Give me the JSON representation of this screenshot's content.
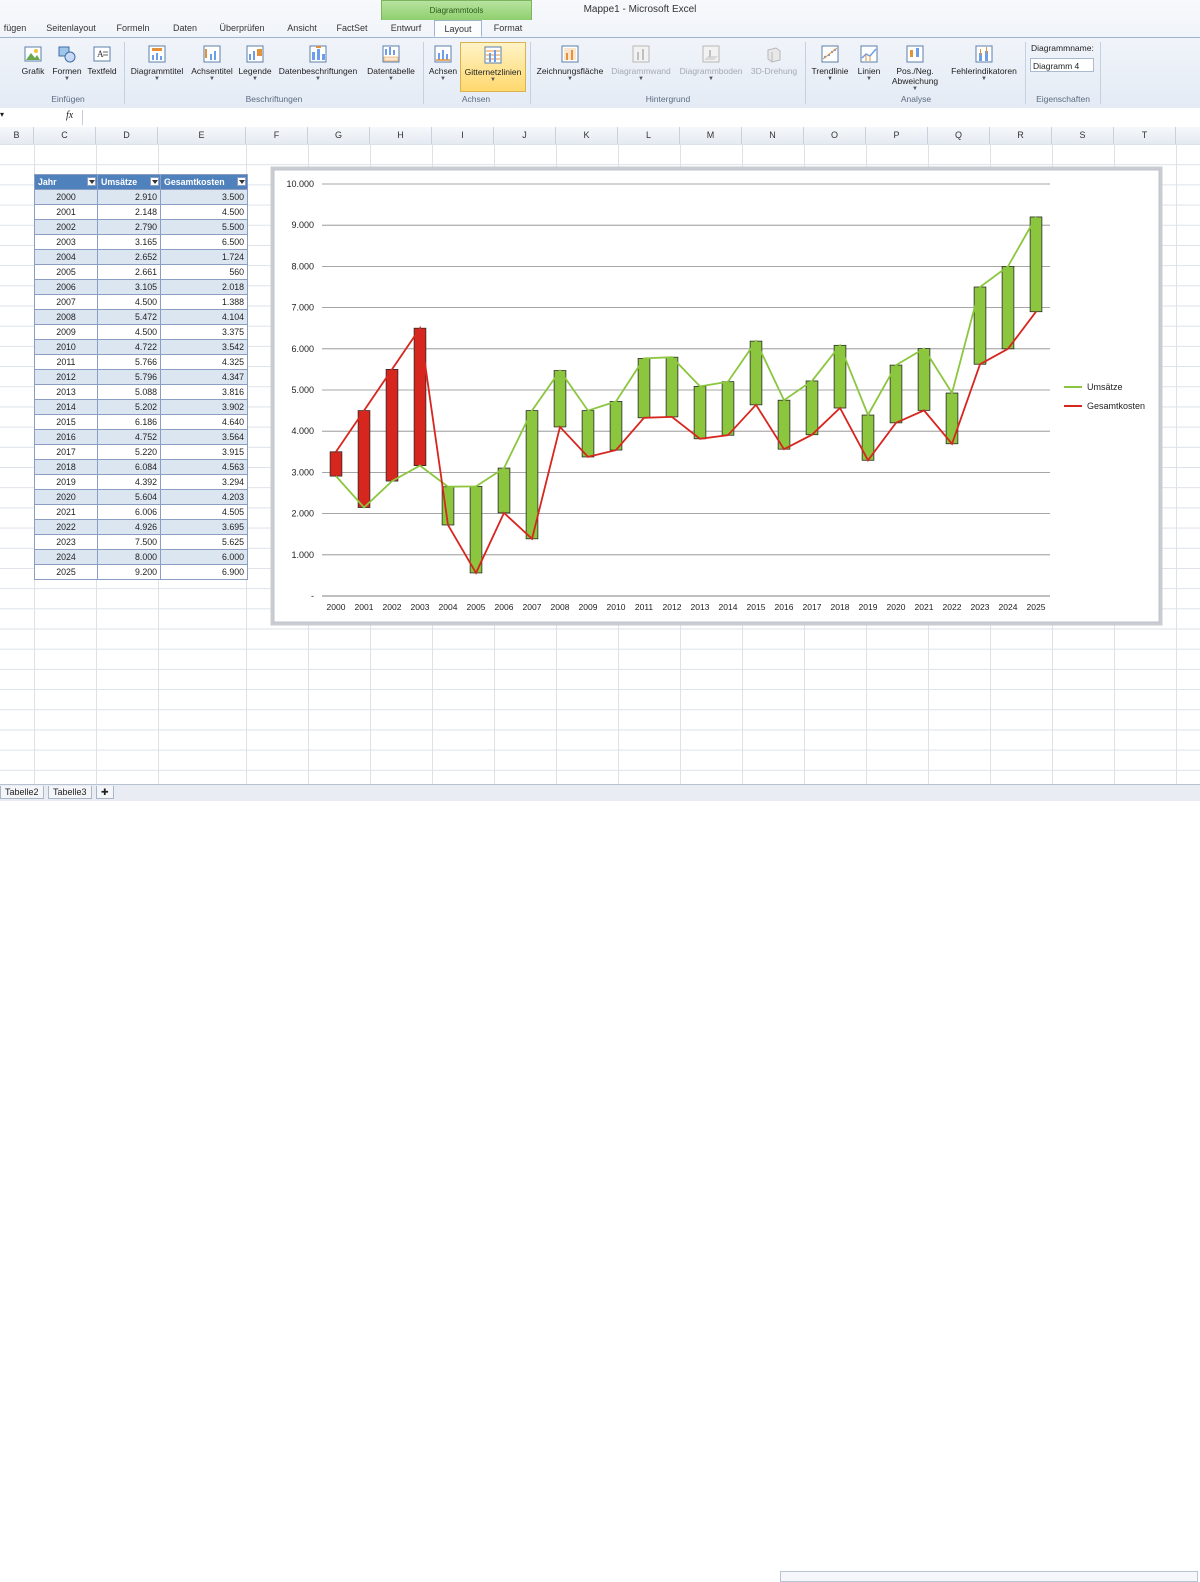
{
  "app": {
    "title": "Mappe1 - Microsoft Excel"
  },
  "ribbon": {
    "context_label": "Diagrammtools",
    "tabs": [
      "fügen",
      "Seitenlayout",
      "Formeln",
      "Daten",
      "Überprüfen",
      "Ansicht",
      "FactSet",
      "Entwurf",
      "Layout",
      "Format"
    ],
    "active_tab": "Layout",
    "groups": {
      "einfuegen": {
        "label": "Einfügen",
        "buttons": [
          "Grafik",
          "Formen",
          "Textfeld"
        ]
      },
      "beschriftungen": {
        "label": "Beschriftungen",
        "buttons": [
          "Diagrammtitel",
          "Achsentitel",
          "Legende",
          "Datenbeschriftungen",
          "Datentabelle"
        ]
      },
      "achsen": {
        "label": "Achsen",
        "buttons": [
          "Achsen",
          "Gitternetzlinien"
        ]
      },
      "hintergrund": {
        "label": "Hintergrund",
        "buttons": [
          "Zeichnungsfläche",
          "Diagrammwand",
          "Diagrammboden",
          "3D-Drehung"
        ]
      },
      "analyse": {
        "label": "Analyse",
        "buttons": [
          "Trendlinie",
          "Linien",
          "Pos./Neg. Abweichung",
          "Fehlerindikatoren"
        ]
      },
      "eigenschaften": {
        "label": "Eigenschaften",
        "name_label": "Diagrammname:",
        "name_value": "Diagramm 4"
      }
    }
  },
  "formula_bar": {
    "fx": "fx"
  },
  "columns": [
    "B",
    "C",
    "D",
    "E",
    "F",
    "G",
    "H",
    "I",
    "J",
    "K",
    "L",
    "M",
    "N",
    "O",
    "P",
    "Q",
    "R",
    "S",
    "T"
  ],
  "table": {
    "headers": [
      "Jahr",
      "Umsätze",
      "Gesamtkosten"
    ],
    "rows": [
      [
        "2000",
        "2.910",
        "3.500"
      ],
      [
        "2001",
        "2.148",
        "4.500"
      ],
      [
        "2002",
        "2.790",
        "5.500"
      ],
      [
        "2003",
        "3.165",
        "6.500"
      ],
      [
        "2004",
        "2.652",
        "1.724"
      ],
      [
        "2005",
        "2.661",
        "560"
      ],
      [
        "2006",
        "3.105",
        "2.018"
      ],
      [
        "2007",
        "4.500",
        "1.388"
      ],
      [
        "2008",
        "5.472",
        "4.104"
      ],
      [
        "2009",
        "4.500",
        "3.375"
      ],
      [
        "2010",
        "4.722",
        "3.542"
      ],
      [
        "2011",
        "5.766",
        "4.325"
      ],
      [
        "2012",
        "5.796",
        "4.347"
      ],
      [
        "2013",
        "5.088",
        "3.816"
      ],
      [
        "2014",
        "5.202",
        "3.902"
      ],
      [
        "2015",
        "6.186",
        "4.640"
      ],
      [
        "2016",
        "4.752",
        "3.564"
      ],
      [
        "2017",
        "5.220",
        "3.915"
      ],
      [
        "2018",
        "6.084",
        "4.563"
      ],
      [
        "2019",
        "4.392",
        "3.294"
      ],
      [
        "2020",
        "5.604",
        "4.203"
      ],
      [
        "2021",
        "6.006",
        "4.505"
      ],
      [
        "2022",
        "4.926",
        "3.695"
      ],
      [
        "2023",
        "7.500",
        "5.625"
      ],
      [
        "2024",
        "8.000",
        "6.000"
      ],
      [
        "2025",
        "9.200",
        "6.900"
      ]
    ]
  },
  "chart_data": {
    "type": "line",
    "categories": [
      "2000",
      "2001",
      "2002",
      "2003",
      "2004",
      "2005",
      "2006",
      "2007",
      "2008",
      "2009",
      "2010",
      "2011",
      "2012",
      "2013",
      "2014",
      "2015",
      "2016",
      "2017",
      "2018",
      "2019",
      "2020",
      "2021",
      "2022",
      "2023",
      "2024",
      "2025"
    ],
    "series": [
      {
        "name": "Umsätze",
        "color": "#8cc63f",
        "values": [
          2910,
          2148,
          2790,
          3165,
          2652,
          2661,
          3105,
          4500,
          5472,
          4500,
          4722,
          5766,
          5796,
          5088,
          5202,
          6186,
          4752,
          5220,
          6084,
          4392,
          5604,
          6006,
          4926,
          7500,
          8000,
          9200
        ]
      },
      {
        "name": "Gesamtkosten",
        "color": "#d7261e",
        "values": [
          3500,
          4500,
          5500,
          6500,
          1724,
          560,
          2018,
          1388,
          4104,
          3375,
          3542,
          4325,
          4347,
          3816,
          3902,
          4640,
          3564,
          3915,
          4563,
          3294,
          4203,
          4505,
          3695,
          5625,
          6000,
          6900
        ]
      }
    ],
    "updown_bars": {
      "up_color": "#8cc63f",
      "down_color": "#d7261e"
    },
    "y_ticks": [
      "-",
      "1.000",
      "2.000",
      "3.000",
      "4.000",
      "5.000",
      "6.000",
      "7.000",
      "8.000",
      "9.000",
      "10.000"
    ],
    "ylim": [
      0,
      10000
    ],
    "grid": true,
    "legend_position": "right"
  },
  "sheet_tabs": [
    "Tabelle2",
    "Tabelle3"
  ]
}
